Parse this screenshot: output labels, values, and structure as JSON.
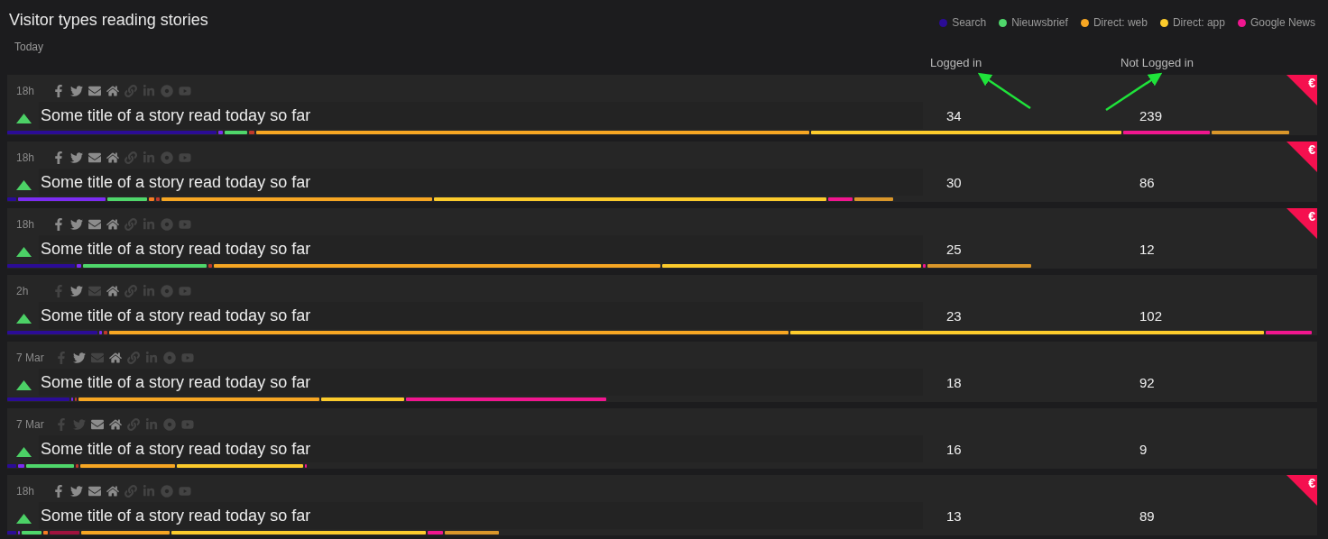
{
  "title": "Visitor types reading stories",
  "period": "Today",
  "legend": [
    {
      "label": "Search",
      "color": "#2b0c96"
    },
    {
      "label": "Nieuwsbrief",
      "color": "#4fd66b"
    },
    {
      "label": "Direct: web",
      "color": "#f6a623"
    },
    {
      "label": "Direct: app",
      "color": "#fccb2c"
    },
    {
      "label": "Google News",
      "color": "#f0168f"
    }
  ],
  "columns": [
    "Logged in",
    "Not Logged in"
  ],
  "stories": [
    {
      "time": "18h",
      "title": "Some title of a story read today so far",
      "logged_in": "34",
      "not_logged_in": "239",
      "badge": "€",
      "channels": [
        {
          "kind": "facebook",
          "active": true
        },
        {
          "kind": "twitter",
          "active": true
        },
        {
          "kind": "mail",
          "active": true
        },
        {
          "kind": "home",
          "active": true
        },
        {
          "kind": "link",
          "active": false
        },
        {
          "kind": "linkedin",
          "active": false
        },
        {
          "kind": "record",
          "active": false
        },
        {
          "kind": "youtube",
          "active": false
        }
      ],
      "segments": [
        {
          "color": "#2b0c96"
        },
        {
          "color": "#7c2cf2"
        },
        {
          "color": "#4fd66b"
        },
        {
          "color": "#c0392b"
        },
        {
          "color": "#f6a623"
        },
        {
          "color": "#fccb2c"
        },
        {
          "color": "#f0168f"
        },
        {
          "color": "#d9962a"
        }
      ]
    },
    {
      "time": "18h",
      "title": "Some title of a story read today so far",
      "logged_in": "30",
      "not_logged_in": "86",
      "badge": "€",
      "channels": [
        {
          "kind": "facebook",
          "active": true
        },
        {
          "kind": "twitter",
          "active": true
        },
        {
          "kind": "mail",
          "active": true
        },
        {
          "kind": "home",
          "active": true
        },
        {
          "kind": "link",
          "active": false
        },
        {
          "kind": "linkedin",
          "active": false
        },
        {
          "kind": "record",
          "active": false
        },
        {
          "kind": "youtube",
          "active": false
        }
      ],
      "segments": [
        {
          "color": "#2b0c96"
        },
        {
          "color": "#7c2cf2"
        },
        {
          "color": "#4fd66b"
        },
        {
          "color": "#f57c23"
        },
        {
          "color": "#c0392b"
        },
        {
          "color": "#f6a623"
        },
        {
          "color": "#fccb2c"
        },
        {
          "color": "#f0168f"
        },
        {
          "color": "#d9962a"
        }
      ]
    },
    {
      "time": "18h",
      "title": "Some title of a story read today so far",
      "logged_in": "25",
      "not_logged_in": "12",
      "badge": "€",
      "channels": [
        {
          "kind": "facebook",
          "active": true
        },
        {
          "kind": "twitter",
          "active": true
        },
        {
          "kind": "mail",
          "active": true
        },
        {
          "kind": "home",
          "active": true
        },
        {
          "kind": "link",
          "active": false
        },
        {
          "kind": "linkedin",
          "active": false
        },
        {
          "kind": "record",
          "active": false
        },
        {
          "kind": "youtube",
          "active": false
        }
      ],
      "segments": [
        {
          "color": "#2b0c96"
        },
        {
          "color": "#7c2cf2"
        },
        {
          "color": "#4fd66b"
        },
        {
          "color": "#c0392b"
        },
        {
          "color": "#f6a623"
        },
        {
          "color": "#fccb2c"
        },
        {
          "color": "#f0168f"
        },
        {
          "color": "#d9962a"
        }
      ]
    },
    {
      "time": "2h",
      "title": "Some title of a story read today so far",
      "logged_in": "23",
      "not_logged_in": "102",
      "channels": [
        {
          "kind": "facebook",
          "active": false
        },
        {
          "kind": "twitter",
          "active": true
        },
        {
          "kind": "mail",
          "active": false
        },
        {
          "kind": "home",
          "active": true
        },
        {
          "kind": "link",
          "active": false
        },
        {
          "kind": "linkedin",
          "active": false
        },
        {
          "kind": "record",
          "active": false
        },
        {
          "kind": "youtube",
          "active": false
        }
      ],
      "segments": [
        {
          "color": "#2b0c96"
        },
        {
          "color": "#7c2cf2"
        },
        {
          "color": "#c0392b"
        },
        {
          "color": "#f6a623"
        },
        {
          "color": "#fccb2c"
        },
        {
          "color": "#f0168f"
        }
      ]
    },
    {
      "time": "7 Mar",
      "title": "Some title of a story read today so far",
      "logged_in": "18",
      "not_logged_in": "92",
      "channels": [
        {
          "kind": "facebook",
          "active": false
        },
        {
          "kind": "twitter",
          "active": true
        },
        {
          "kind": "mail",
          "active": false
        },
        {
          "kind": "home",
          "active": true
        },
        {
          "kind": "link",
          "active": false
        },
        {
          "kind": "linkedin",
          "active": false
        },
        {
          "kind": "record",
          "active": false
        },
        {
          "kind": "youtube",
          "active": false
        }
      ],
      "segments": [
        {
          "color": "#2b0c96"
        },
        {
          "color": "#7c2cf2"
        },
        {
          "color": "#c0392b"
        },
        {
          "color": "#f6a623"
        },
        {
          "color": "#fccb2c"
        },
        {
          "color": "#f0168f"
        }
      ]
    },
    {
      "time": "7 Mar",
      "title": "Some title of a story read today so far",
      "logged_in": "16",
      "not_logged_in": "9",
      "channels": [
        {
          "kind": "facebook",
          "active": false
        },
        {
          "kind": "twitter",
          "active": false
        },
        {
          "kind": "mail",
          "active": true
        },
        {
          "kind": "home",
          "active": true
        },
        {
          "kind": "link",
          "active": false
        },
        {
          "kind": "linkedin",
          "active": false
        },
        {
          "kind": "record",
          "active": false
        },
        {
          "kind": "youtube",
          "active": false
        }
      ],
      "segments": [
        {
          "color": "#2b0c96"
        },
        {
          "color": "#7c2cf2"
        },
        {
          "color": "#4fd66b"
        },
        {
          "color": "#c0392b"
        },
        {
          "color": "#f6a623"
        },
        {
          "color": "#fccb2c"
        },
        {
          "color": "#f0168f"
        }
      ]
    },
    {
      "time": "18h",
      "title": "Some title of a story read today so far",
      "logged_in": "13",
      "not_logged_in": "89",
      "badge": "€",
      "channels": [
        {
          "kind": "facebook",
          "active": true
        },
        {
          "kind": "twitter",
          "active": true
        },
        {
          "kind": "mail",
          "active": true
        },
        {
          "kind": "home",
          "active": true
        },
        {
          "kind": "link",
          "active": false
        },
        {
          "kind": "linkedin",
          "active": false
        },
        {
          "kind": "record",
          "active": false
        },
        {
          "kind": "youtube",
          "active": false
        }
      ],
      "segments": [
        {
          "color": "#2b0c96"
        },
        {
          "color": "#7c2cf2"
        },
        {
          "color": "#4fd66b"
        },
        {
          "color": "#f57c23"
        },
        {
          "color": "#a0123e"
        },
        {
          "color": "#f6a623"
        },
        {
          "color": "#fccb2c"
        },
        {
          "color": "#f0168f"
        },
        {
          "color": "#d9962a"
        }
      ]
    }
  ]
}
